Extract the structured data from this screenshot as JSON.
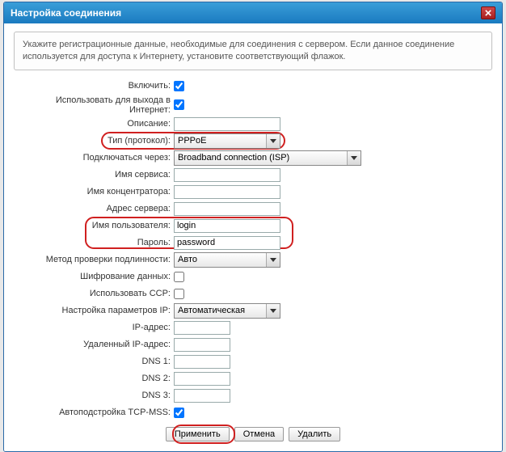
{
  "title": "Настройка соединения",
  "hint": "Укажите регистрационные данные, необходимые для соединения с сервером. Если данное соединение используется для доступа к Интернету, установите соответствующий флажок.",
  "labels": {
    "enable": "Включить:",
    "inet": "Использовать для выхода в Интернет:",
    "desc": "Описание:",
    "proto": "Тип (протокол):",
    "via": "Подключаться через:",
    "svc": "Имя сервиса:",
    "conc": "Имя концентратора:",
    "srv": "Адрес сервера:",
    "user": "Имя пользователя:",
    "pass": "Пароль:",
    "auth": "Метод проверки подлинности:",
    "encr": "Шифрование данных:",
    "ccp": "Использовать CCP:",
    "ip": "Настройка параметров IP:",
    "ipaddr": "IP-адрес:",
    "remip": "Удаленный IP-адрес:",
    "dns1": "DNS 1:",
    "dns2": "DNS 2:",
    "dns3": "DNS 3:",
    "mss": "Автоподстройка TCP-MSS:"
  },
  "values": {
    "enable": true,
    "inet": true,
    "desc": "",
    "proto": "PPPoE",
    "via": "Broadband connection (ISP)",
    "svc": "",
    "conc": "",
    "srv": "",
    "user": "login",
    "pass": "password",
    "auth": "Авто",
    "encr": false,
    "ccp": false,
    "ip": "Автоматическая",
    "ipaddr": "",
    "remip": "",
    "dns1": "",
    "dns2": "",
    "dns3": "",
    "mss": true
  },
  "buttons": {
    "apply": "Применить",
    "cancel": "Отмена",
    "delete": "Удалить"
  }
}
